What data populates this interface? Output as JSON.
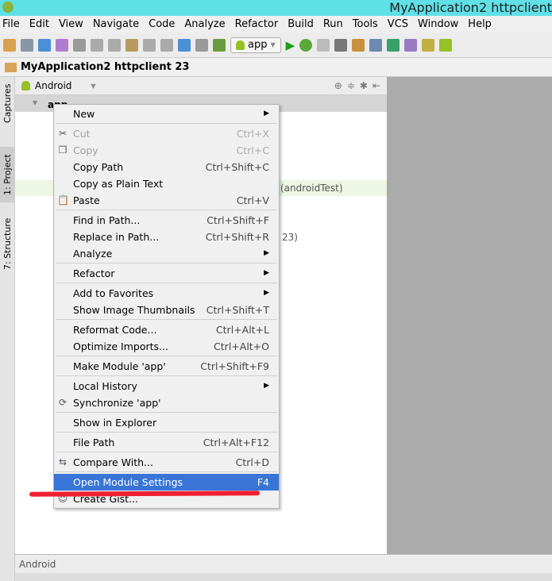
{
  "window": {
    "title": "MyApplication2 httpclient"
  },
  "menubar": [
    "File",
    "Edit",
    "View",
    "Navigate",
    "Code",
    "Analyze",
    "Refactor",
    "Build",
    "Run",
    "Tools",
    "VCS",
    "Window",
    "Help"
  ],
  "toolbar": {
    "run_config": "app"
  },
  "breadcrumb": "MyApplication2 httpclient 23",
  "side_tabs": [
    "Captures",
    "1: Project",
    "7: Structure"
  ],
  "panel": {
    "view_selector": "Android",
    "root": "app"
  },
  "tree_fragments": [
    "(androidTest)",
    "23)"
  ],
  "bottom": {
    "label": "Android"
  },
  "context_menu": [
    {
      "label": "New",
      "submenu": true
    },
    {
      "sep": true
    },
    {
      "label": "Cut",
      "shortcut": "Ctrl+X",
      "disabled": true,
      "icon": "scissors-icon"
    },
    {
      "label": "Copy",
      "shortcut": "Ctrl+C",
      "disabled": true,
      "icon": "copy-icon"
    },
    {
      "label": "Copy Path",
      "shortcut": "Ctrl+Shift+C"
    },
    {
      "label": "Copy as Plain Text"
    },
    {
      "label": "Paste",
      "shortcut": "Ctrl+V",
      "icon": "paste-icon"
    },
    {
      "sep": true
    },
    {
      "label": "Find in Path...",
      "shortcut": "Ctrl+Shift+F"
    },
    {
      "label": "Replace in Path...",
      "shortcut": "Ctrl+Shift+R"
    },
    {
      "label": "Analyze",
      "submenu": true
    },
    {
      "sep": true
    },
    {
      "label": "Refactor",
      "submenu": true
    },
    {
      "sep": true
    },
    {
      "label": "Add to Favorites",
      "submenu": true
    },
    {
      "label": "Show Image Thumbnails",
      "shortcut": "Ctrl+Shift+T"
    },
    {
      "sep": true
    },
    {
      "label": "Reformat Code...",
      "shortcut": "Ctrl+Alt+L"
    },
    {
      "label": "Optimize Imports...",
      "shortcut": "Ctrl+Alt+O"
    },
    {
      "sep": true
    },
    {
      "label": "Make Module 'app'",
      "shortcut": "Ctrl+Shift+F9"
    },
    {
      "sep": true
    },
    {
      "label": "Local History",
      "submenu": true
    },
    {
      "label": "Synchronize 'app'",
      "icon": "sync-icon"
    },
    {
      "sep": true
    },
    {
      "label": "Show in Explorer"
    },
    {
      "sep": true
    },
    {
      "label": "File Path",
      "shortcut": "Ctrl+Alt+F12"
    },
    {
      "sep": true
    },
    {
      "label": "Compare With...",
      "shortcut": "Ctrl+D",
      "icon": "compare-icon"
    },
    {
      "sep": true
    },
    {
      "label": "Open Module Settings",
      "shortcut": "F4",
      "selected": true
    },
    {
      "label": "Create Gist...",
      "icon": "github-icon"
    }
  ],
  "colors": {
    "titlebar": "#5fe0e6",
    "selection": "#3875d7",
    "annotation": "#ef2030"
  }
}
